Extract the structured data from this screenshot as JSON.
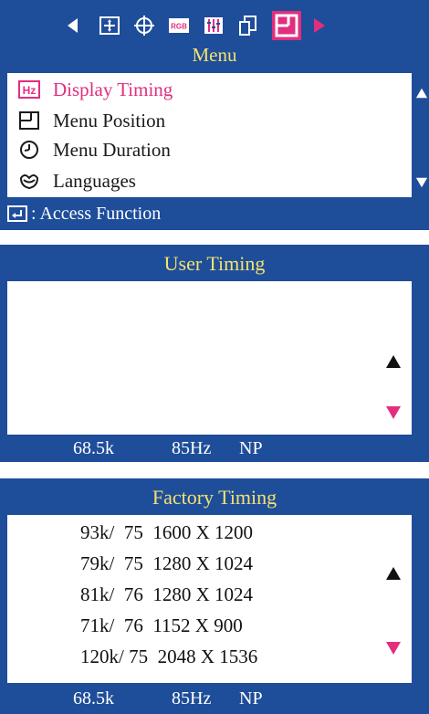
{
  "menu": {
    "title": "Menu",
    "icons": [
      {
        "name": "left-arrow-icon"
      },
      {
        "name": "picture-icon"
      },
      {
        "name": "geometry-icon"
      },
      {
        "name": "rgb-icon",
        "label": "RGB"
      },
      {
        "name": "color-bars-icon"
      },
      {
        "name": "image-copy-icon"
      },
      {
        "name": "setup-icon",
        "active": true
      },
      {
        "name": "right-arrow-icon"
      }
    ],
    "items": [
      {
        "label": "Display Timing",
        "icon": "hz-icon",
        "icon_text": "Hz",
        "selected": true
      },
      {
        "label": "Menu Position",
        "icon": "menu-position-icon"
      },
      {
        "label": "Menu Duration",
        "icon": "clock-icon"
      },
      {
        "label": "Languages",
        "icon": "languages-icon"
      }
    ],
    "access_hint": ": Access Function"
  },
  "user_timing": {
    "title": "User Timing",
    "status": {
      "freq": "68.5k",
      "refresh": "85Hz",
      "polarity": "NP"
    }
  },
  "factory_timing": {
    "title": "Factory Timing",
    "rows": [
      "93k/  75  1600 X 1200",
      "79k/  75  1280 X 1024",
      "81k/  76  1280 X 1024",
      "71k/  76  1152 X 900",
      "120k/ 75  2048 X 1536"
    ],
    "status": {
      "freq": "68.5k",
      "refresh": "85Hz",
      "polarity": "NP"
    }
  },
  "colors": {
    "panel_bg": "#1e4d9a",
    "title_yellow": "#f4e26e",
    "accent_magenta": "#e22e7e"
  }
}
